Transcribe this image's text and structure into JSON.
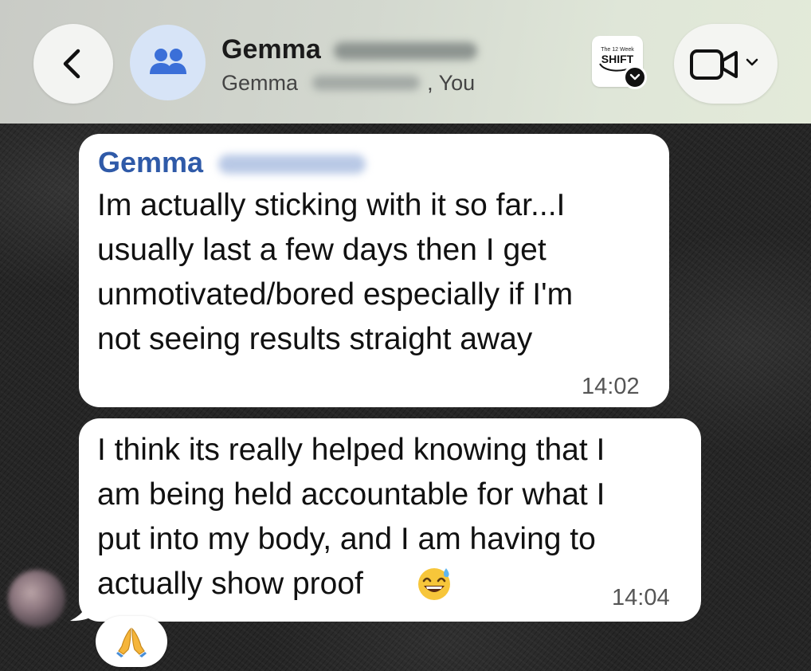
{
  "header": {
    "chat_title": "Gemma",
    "subtitle_member": "Gemma",
    "subtitle_separator": ", You",
    "brand_logo_small": "The 12 Week",
    "brand_logo_big": "SHIFT",
    "icons": {
      "back": "chevron-left-icon",
      "group": "group-people-icon",
      "video": "video-camera-icon",
      "video_menu": "chevron-down-icon",
      "verified": "verified-badge-icon"
    }
  },
  "messages": [
    {
      "sender": "Gemma",
      "sender_color": "#2f5aa8",
      "text_lines": [
        "Im actually sticking with it so far...I",
        "usually last a few days then I get",
        "unmotivated/bored especially if I'm",
        "not seeing results straight away"
      ],
      "time": "14:02"
    },
    {
      "text_lines": [
        "I think its really helped knowing that I",
        "am being held accountable for what I",
        "put into my body, and I am having to",
        "actually show proof"
      ],
      "emoji": "grinning-face-with-sweat",
      "time": "14:04",
      "reaction": "folded-hands"
    }
  ],
  "colors": {
    "bubble": "#ffffff",
    "chat_background": "#262626",
    "group_avatar_bg": "#d7e4f7",
    "group_icon": "#3b6fd8"
  }
}
